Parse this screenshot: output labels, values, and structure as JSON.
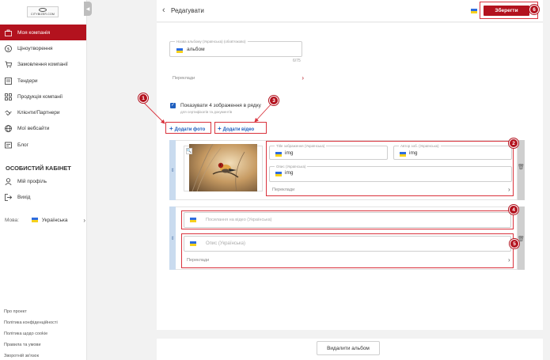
{
  "sidebar": {
    "logo_text": "CITYBIZER.COM",
    "items": [
      {
        "label": "Моя компанія",
        "icon": "briefcase-icon",
        "active": true
      },
      {
        "label": "Ціноутворення",
        "icon": "dollar-icon"
      },
      {
        "label": "Замовлення компанії",
        "icon": "cart-icon"
      },
      {
        "label": "Тендери",
        "icon": "tender-icon"
      },
      {
        "label": "Продукція компанії",
        "icon": "grid-icon"
      },
      {
        "label": "Клієнти/Партнери",
        "icon": "handshake-icon"
      },
      {
        "label": "Мої вебсайти",
        "icon": "globe-icon"
      },
      {
        "label": "Блог",
        "icon": "blog-icon"
      }
    ],
    "cabinet_title": "ОСОБИСТИЙ КАБІНЕТ",
    "cabinet_items": [
      {
        "label": "Мій профіль",
        "icon": "user-icon"
      },
      {
        "label": "Вихід",
        "icon": "logout-icon"
      }
    ],
    "language_label": "Мова:",
    "language_value": "Українська",
    "footer_links": [
      "Про проект",
      "Політика конфіденційності",
      "Політика щодо cookie",
      "Правила та умови",
      "Зворотній зв'язок"
    ]
  },
  "header": {
    "title": "Редагувати",
    "save_label": "Зберегти"
  },
  "album": {
    "name_label": "Назва альбому (Українська) (обов'язково)",
    "name_value": "альбом",
    "counter": "6/75",
    "translations_label": "Переклади"
  },
  "options": {
    "checkbox_label": "Показувати 4 зображення в рядку",
    "checkbox_sub": "для сертифікатів та документів",
    "checked": true,
    "add_photo": "Додати фото",
    "add_video": "Додати відео"
  },
  "photo_block": {
    "title_label": "Title зображення (Українська)",
    "title_value": "img",
    "author_label": "Автор зоб. (Українська)",
    "author_value": "img",
    "desc_label": "Опис (Українська)",
    "desc_value": "img",
    "translations_label": "Переклади"
  },
  "video_block": {
    "link_placeholder": "Посилання на відео (Українська)",
    "desc_placeholder": "Опис (Українська)",
    "translations_label": "Переклади"
  },
  "footer": {
    "delete_label": "Видалити альбом"
  },
  "badges": [
    "1",
    "2",
    "3",
    "4",
    "5",
    "6"
  ],
  "colors": {
    "brand": "#b3121e",
    "accent": "#1f5fbf",
    "highlight": "#d9323c"
  }
}
